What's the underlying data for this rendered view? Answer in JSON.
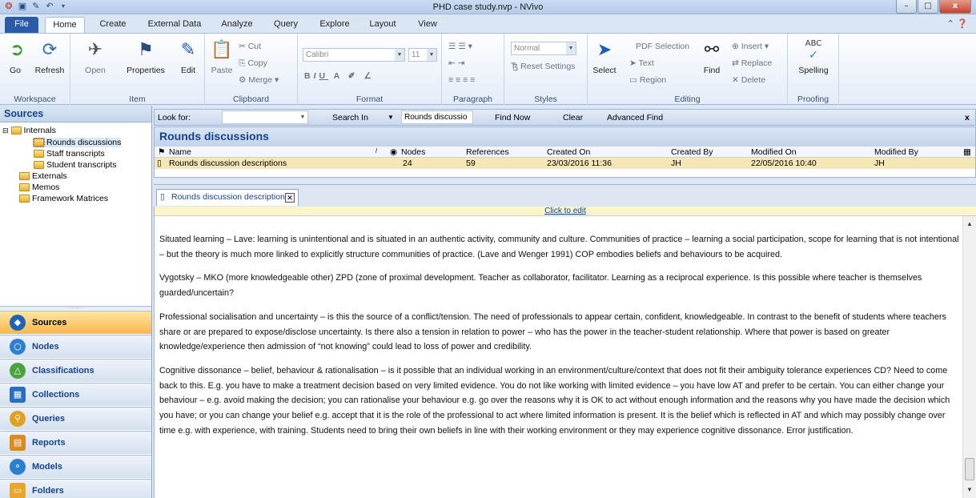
{
  "window": {
    "title": "PHD case study.nvp - NVivo",
    "controls": {
      "minimize": "–",
      "maximize": "□",
      "close": "x"
    }
  },
  "quick_access": [
    "nvivo-icon",
    "save-icon",
    "edit-icon",
    "undo-icon",
    "dropdown-icon"
  ],
  "ribbon_tabs": [
    {
      "label": "File"
    },
    {
      "label": "Home"
    },
    {
      "label": "Create"
    },
    {
      "label": "External Data"
    },
    {
      "label": "Analyze"
    },
    {
      "label": "Query"
    },
    {
      "label": "Explore"
    },
    {
      "label": "Layout"
    },
    {
      "label": "View"
    }
  ],
  "ribbon": {
    "workspace": {
      "label": "Workspace",
      "go": "Go",
      "refresh": "Refresh"
    },
    "item": {
      "label": "Item",
      "open": "Open",
      "properties": "Properties",
      "edit": "Edit"
    },
    "clipboard": {
      "label": "Clipboard",
      "paste": "Paste",
      "cut": "Cut",
      "copy": "Copy",
      "merge": "Merge"
    },
    "format": {
      "label": "Format",
      "font": "Calibri",
      "size": "11",
      "bold": "B",
      "italic": "I",
      "underline": "U",
      "color": "A"
    },
    "paragraph": {
      "label": "Paragraph"
    },
    "styles": {
      "label": "Styles",
      "style": "Normal",
      "reset": "Reset Settings"
    },
    "editing": {
      "label": "Editing",
      "select": "Select",
      "pdf_selection": "PDF Selection",
      "text": "Text",
      "region": "Region",
      "find": "Find",
      "insert": "Insert",
      "replace": "Replace",
      "delete": "Delete"
    },
    "proofing": {
      "label": "Proofing",
      "spelling": "Spelling",
      "abc": "ABC"
    }
  },
  "sources_pane": {
    "title": "Sources",
    "tree": [
      {
        "label": "Internals",
        "level": 0,
        "expander": "⊟"
      },
      {
        "label": "Rounds discussions",
        "level": 2,
        "selected": true
      },
      {
        "label": "Staff transcripts",
        "level": 2
      },
      {
        "label": "Student transcripts",
        "level": 2
      },
      {
        "label": "Externals",
        "level": 1
      },
      {
        "label": "Memos",
        "level": 1
      },
      {
        "label": "Framework Matrices",
        "level": 1
      }
    ],
    "nav": [
      {
        "label": "Sources",
        "icon": "sources-icon",
        "color": "#1f63b8",
        "active": true
      },
      {
        "label": "Nodes",
        "icon": "nodes-icon",
        "color": "#2f7fd1"
      },
      {
        "label": "Classifications",
        "icon": "classifications-icon",
        "color": "#4aa33c"
      },
      {
        "label": "Collections",
        "icon": "collections-icon",
        "color": "#2a6fbf"
      },
      {
        "label": "Queries",
        "icon": "queries-icon",
        "color": "#e0a020"
      },
      {
        "label": "Reports",
        "icon": "reports-icon",
        "color": "#d98c1e"
      },
      {
        "label": "Models",
        "icon": "models-icon",
        "color": "#2a7fd0"
      },
      {
        "label": "Folders",
        "icon": "folders-icon",
        "color": "#e8a62a"
      }
    ]
  },
  "find_bar": {
    "look_for": "Look for:",
    "search_in": "Search In",
    "search_in_value": "Rounds discussio",
    "find_now": "Find Now",
    "clear": "Clear",
    "advanced_find": "Advanced Find",
    "close": "x"
  },
  "list_view": {
    "title": "Rounds discussions",
    "columns": [
      "Name",
      "Nodes",
      "References",
      "Created On",
      "Created By",
      "Modified On",
      "Modified By"
    ],
    "rows": [
      {
        "name": "Rounds discussion descriptions",
        "nodes": "24",
        "references": "59",
        "created_on": "23/03/2016 11:36",
        "created_by": "JH",
        "modified_on": "22/05/2016 10:40",
        "modified_by": "JH"
      }
    ]
  },
  "document": {
    "tab_label": "Rounds discussion description",
    "click_to_edit": "Click to edit",
    "paragraphs": [
      "Situated learning – Lave: learning is unintentional and is situated in an authentic activity, community and culture.  Communities of practice – learning a social participation, scope for learning that is not intentional – but the theory is much more linked to explicitly structure communities of practice. (Lave and Wenger 1991)  COP embodies beliefs and behaviours to be acquired.",
      "Vygotsky – MKO (more knowledgeable other) ZPD (zone of proximal development.  Teacher as collaborator, facilitator.  Learning as a reciprocal experience.  Is this possible where teacher is themselves guarded/uncertain?",
      "Professional socialisation and uncertainty – is this the source of a conflict/tension.  The need of professionals to appear certain, confident, knowledgeable. In contrast to the benefit of students where teachers share or are prepared to expose/disclose uncertainty.  Is there also a tension in relation to power – who has the power in the teacher-student relationship.  Where that power is based on greater knowledge/experience then admission of “not knowing” could lead to loss of power and credibility.",
      "Cognitive dissonance – belief, behaviour & rationalisation – is it possible that an individual working in an environment/culture/context that does not fit their ambiguity tolerance experiences CD?  Need to come back to this. E.g. you have to make a treatment decision based on very limited evidence.  You do not like working with limited evidence – you have low AT and prefer to be certain.  You can either change your behaviour – e.g. avoid making the decision; you can rationalise your behaviour e.g. go over the reasons why it is OK to act without enough information and the reasons why you have made the decision which you have; or you can change your belief e.g. accept that it is the role of the professional to act where limited information is present.  It is the belief which is reflected in AT and which may possibly change over time e.g. with experience, with training.  Students need to bring their own beliefs in line with their working environment or they may experience cognitive dissonance.  Error justification."
    ]
  }
}
